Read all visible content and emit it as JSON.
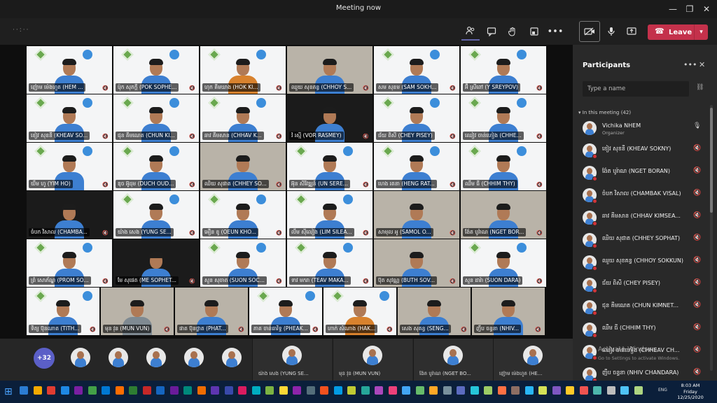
{
  "window": {
    "title": "Meeting now",
    "minimize": "—",
    "maximize": "❐",
    "close": "✕"
  },
  "toolbar": {
    "timer": "··:··",
    "leave_label": "Leave",
    "icons": [
      "people-icon",
      "chat-icon",
      "raise-hand-icon",
      "breakout-icon",
      "more-icon",
      "camera-icon",
      "mic-icon",
      "share-icon"
    ]
  },
  "tiles": [
    {
      "name": "ញ៉ោម ម៉េងហួត (HEM ...",
      "bg": "banner",
      "shirt": "blue"
    },
    {
      "name": "ប៉ុក សុភក្តី (POK SOPHE...",
      "bg": "banner",
      "shirt": "blue"
    },
    {
      "name": "ហុក គីមឃាង (HOK KI...",
      "bg": "banner",
      "shirt": "orange"
    },
    {
      "name": "ឈួយ សុខគន្ធ (CHHOY S...",
      "bg": "room",
      "shirt": "blue"
    },
    {
      "name": "សម សុខម (SAM SOKH...",
      "bg": "banner",
      "shirt": "blue"
    },
    {
      "name": "អ៊ី ស្រីពៅ (Y SREYPOV)",
      "bg": "banner",
      "shirt": "blue"
    },
    {
      "name": "ខៀវ សុខនី (KHEAV SO...",
      "bg": "banner",
      "shirt": "blue"
    },
    {
      "name": "ជុន គីមណេត (CHUN KI...",
      "bg": "banner",
      "shirt": "blue"
    },
    {
      "name": "ឆាវ គីមសាន (CHHAV K...",
      "bg": "banner",
      "shirt": "blue"
    },
    {
      "name": "វ៉ រស្មី (VOR RASMEY)",
      "bg": "dark",
      "shirt": "blue"
    },
    {
      "name": "ជ័យ ពិសី (CHEY PISEY)",
      "bg": "banner",
      "shirt": "blue"
    },
    {
      "name": "ឈៀវ ចាន់ហៀង (CHHE...",
      "bg": "banner",
      "shirt": "blue"
    },
    {
      "name": "យឹម ហូ (YIM HO)",
      "bg": "banner",
      "shirt": "blue"
    },
    {
      "name": "ឌុច អ៊ូដុម (DUCH OUD...",
      "bg": "banner",
      "shirt": "blue"
    },
    {
      "name": "ឈិយ សុផាត (CHHEY SO...",
      "bg": "room",
      "shirt": "blue"
    },
    {
      "name": "អ៊ុន សិរីវឌ្ឍន៍ (UN SERE...",
      "bg": "banner",
      "shirt": "blue"
    },
    {
      "name": "ហេង រតនា (HENG RAT...",
      "bg": "banner",
      "shirt": "blue"
    },
    {
      "name": "ឈឹម ធី (CHHIM THY)",
      "bg": "banner",
      "shirt": "blue"
    },
    {
      "name": "ចំបក វិសាល (CHAMBA...",
      "bg": "dark",
      "shirt": "blue"
    },
    {
      "name": "យ៉ាង សេង (YUNG SE...",
      "bg": "banner",
      "shirt": "blue"
    },
    {
      "name": "អឿន ខូ (OEUN KHO...",
      "bg": "banner",
      "shirt": "blue"
    },
    {
      "name": "លឹម ស៊ីលៀង (LIM SILEA...",
      "bg": "banner",
      "shirt": "blue"
    },
    {
      "name": "សាមុល អូ (SAMOL O...",
      "bg": "room",
      "shirt": "blue"
    },
    {
      "name": "ង៉ែត បូរ៉ាណ (NGET BOR...",
      "bg": "room",
      "shirt": "blue"
    },
    {
      "name": "ព្រំ សោភ័ណ្ឌ (PROM SO...",
      "bg": "banner",
      "shirt": "blue"
    },
    {
      "name": "មែ សុផេត (ME SOPHET...",
      "bg": "dark",
      "shirt": "blue"
    },
    {
      "name": "សួន សុចាត (SUON SOC...",
      "bg": "banner",
      "shirt": "blue"
    },
    {
      "name": "ទាវ មករា (TEAV MAKA...",
      "bg": "banner",
      "shirt": "blue"
    },
    {
      "name": "ប៊ុត សុវណ្ណ (BUTH SOV...",
      "bg": "room",
      "shirt": "blue"
    },
    {
      "name": "សួន ដារ៉ា (SUON DARA)",
      "bg": "banner",
      "shirt": "blue"
    },
    {
      "name": "ទិត្យ ប៊ុនណាត (TITH...",
      "bg": "banner",
      "shirt": "blue"
    },
    {
      "name": "មុន វុន (MUN VUN)",
      "bg": "room",
      "shirt": "grey"
    },
    {
      "name": "ផាត ប៊ុនថ្លាត (PHAT...",
      "bg": "room",
      "shirt": "blue"
    },
    {
      "name": "ភាគ ចាន់ធារិទ្ធ (PHEAK...",
      "bg": "banner",
      "shirt": "blue"
    },
    {
      "name": "ហាក់ សំណាង (HAK...",
      "bg": "banner",
      "shirt": "orange"
    },
    {
      "name": "សេង សុគន្ធ (SENG...",
      "bg": "room",
      "shirt": "blue"
    },
    {
      "name": "ញឹប ចន្ធនា (NHIV...",
      "bg": "room",
      "shirt": "blue"
    }
  ],
  "strip": {
    "overflow_count": "+32",
    "tiles": [
      {
        "name": "យ៉ាង សេង (YUNG SE..."
      },
      {
        "name": "មុន វុន (MUN VUN)"
      },
      {
        "name": "ង៉ែត បូរ៉ាណ (NGET BO..."
      },
      {
        "name": "ញ៉ោម ម៉េងហួត (HE..."
      }
    ]
  },
  "panel": {
    "title": "Participants",
    "search_placeholder": "Type a name",
    "section_label": "In this meeting (42)",
    "participants": [
      {
        "name": "Vichika NHEM",
        "role": "Organizer",
        "mic": "🎙"
      },
      {
        "name": "ខៀវ សុខនី (KHEAV SOKNY)",
        "role": "",
        "mic": "🔇"
      },
      {
        "name": "ង៉ែត បូរ៉ាណ (NGET BORAN)",
        "role": "",
        "mic": "🔇"
      },
      {
        "name": "ចំបក វិសាល (CHAMBAK VISAL)",
        "role": "",
        "mic": "🔇"
      },
      {
        "name": "ឆាវ គីមសាន (CHHAV KIMSEA...",
        "role": "",
        "mic": "🔇"
      },
      {
        "name": "ឈិយ សុផាត (CHHEY SOPHAT)",
        "role": "",
        "mic": "🔇"
      },
      {
        "name": "ឈួយ សុខគន្ធ (CHHOY SOKKUN)",
        "role": "",
        "mic": "🔇"
      },
      {
        "name": "ជ័យ ពិសី (CHEY PISEY)",
        "role": "",
        "mic": "🔇"
      },
      {
        "name": "ជុន គីមណេត (CHUN KIMNET...",
        "role": "",
        "mic": "🔇"
      },
      {
        "name": "ឈឹម ធី (CHHIM THY)",
        "role": "",
        "mic": "🔇"
      },
      {
        "name": "ឈៀវ ចាន់ហៀង (CHHEAV CH...",
        "role": "",
        "mic": "🔇"
      },
      {
        "name": "ញឹប ចន្ធនា (NHIV CHANDARA)",
        "role": "",
        "mic": "🔇"
      }
    ]
  },
  "watermark": {
    "line1": "Activate Windows",
    "line2": "Go to Settings to activate Windows."
  },
  "taskbar": {
    "time": "8:03 AM",
    "day": "Friday",
    "date": "12/25/2020",
    "lang": "ENG"
  }
}
